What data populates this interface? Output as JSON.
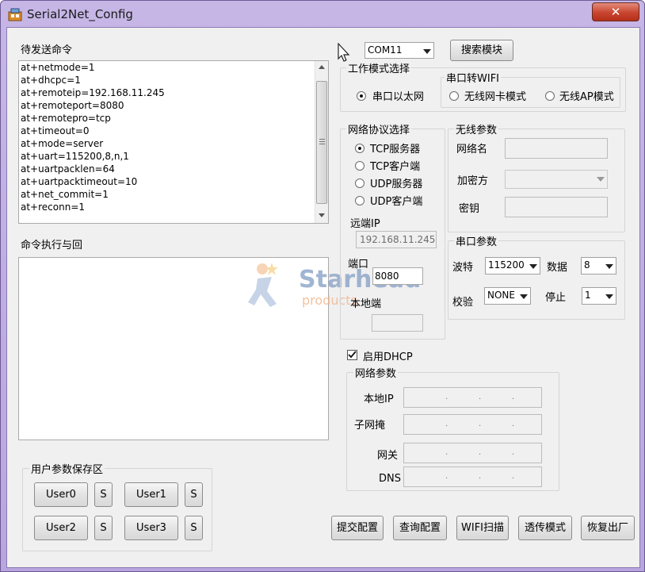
{
  "window": {
    "title": "Serial2Net_Config",
    "close_label": "✕"
  },
  "left": {
    "pending_title": "待发送命令",
    "commands": [
      "at+netmode=1",
      "at+dhcpc=1",
      "at+remoteip=192.168.11.245",
      "at+remoteport=8080",
      "at+remotepro=tcp",
      "at+timeout=0",
      "at+mode=server",
      "at+uart=115200,8,n,1",
      "at+uartpacklen=64",
      "at+uartpacktimeout=10",
      "at+net_commit=1",
      "at+reconn=1"
    ],
    "exec_title": "命令执行与回",
    "watermark": {
      "brand": "Starhead",
      "sub": "products"
    },
    "user_group_title": "用户参数保存区",
    "users": [
      "User0",
      "User1",
      "User2",
      "User3"
    ],
    "save_label": "S"
  },
  "top": {
    "com_port": "COM11",
    "search_label": "搜索模块"
  },
  "work_mode": {
    "title": "工作模式选择",
    "eth_label": "串口以太网",
    "wifi_group_title": "串口转WIFI",
    "wifi_card_label": "无线网卡模式",
    "wifi_ap_label": "无线AP模式"
  },
  "protocol": {
    "title": "网络协议选择",
    "options": [
      "TCP服务器",
      "TCP客户端",
      "UDP服务器",
      "UDP客户端"
    ],
    "remote_ip_label": "远端IP",
    "remote_ip": "192.168.11.245",
    "port_label": "端口",
    "port": "8080",
    "local_port_label": "本地端",
    "local_port": ""
  },
  "wireless": {
    "title": "无线参数",
    "ssid_label": "网络名",
    "enc_label": "加密方",
    "key_label": "密钥"
  },
  "serial": {
    "title": "串口参数",
    "baud_label": "波特",
    "baud": "115200",
    "data_label": "数据",
    "data_bits": "8",
    "parity_label": "校验",
    "parity": "NONE",
    "stop_label": "停止",
    "stop_bits": "1"
  },
  "network": {
    "dhcp_label": "启用DHCP",
    "dhcp_checked": true,
    "title": "网络参数",
    "local_ip_label": "本地IP",
    "subnet_label": "子网掩",
    "gateway_label": "网关",
    "dns_label": "DNS",
    "ip_dot": "."
  },
  "actions": {
    "submit": "提交配置",
    "query": "查询配置",
    "wifi_scan": "WIFI扫描",
    "transparent": "透传模式",
    "factory_reset": "恢复出厂"
  },
  "colors": {
    "title_bar": "#c6b6e6",
    "close_button": "#c9452f",
    "client_bg": "#f0f0f0",
    "watermark_blue": "#8aa3c8",
    "watermark_orange": "#f2b48a"
  }
}
